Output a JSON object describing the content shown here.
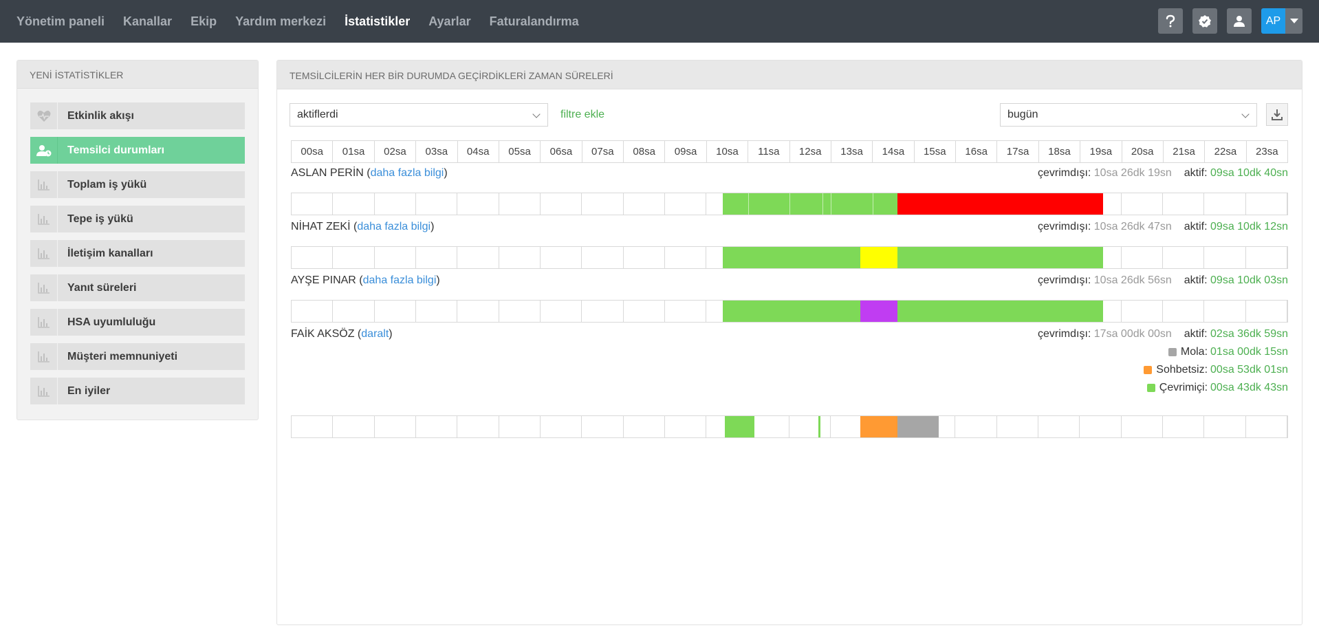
{
  "nav": {
    "items": [
      "Yönetim paneli",
      "Kanallar",
      "Ekip",
      "Yardım merkezi",
      "İstatistikler",
      "Ayarlar",
      "Faturalandırma"
    ],
    "active_index": 4,
    "avatar_initials": "AP"
  },
  "sidebar": {
    "title": "YENİ İSTATİSTİKLER",
    "items": [
      {
        "label": "Etkinlik akışı",
        "icon": "heartbeat-icon"
      },
      {
        "label": "Temsilci durumları",
        "icon": "user-status-icon",
        "active": true
      },
      {
        "label": "Toplam iş yükü",
        "icon": "bar-chart-icon"
      },
      {
        "label": "Tepe iş yükü",
        "icon": "bar-chart-icon"
      },
      {
        "label": "İletişim kanalları",
        "icon": "bar-chart-icon"
      },
      {
        "label": "Yanıt süreleri",
        "icon": "bar-chart-icon"
      },
      {
        "label": "HSA uyumluluğu",
        "icon": "bar-chart-icon"
      },
      {
        "label": "Müşteri memnuniyeti",
        "icon": "bar-chart-icon"
      },
      {
        "label": "En iyiler",
        "icon": "bar-chart-icon"
      }
    ]
  },
  "panel": {
    "title": "TEMSİLCİLERİN HER BİR DURUMDA GEÇİRDİKLERİ ZAMAN SÜRELERİ",
    "agent_filter": "aktiflerdi",
    "add_filter": "filtre ekle",
    "period": "bugün",
    "hours": [
      "00sa",
      "01sa",
      "02sa",
      "03sa",
      "04sa",
      "05sa",
      "06sa",
      "07sa",
      "08sa",
      "09sa",
      "10sa",
      "11sa",
      "12sa",
      "13sa",
      "14sa",
      "15sa",
      "16sa",
      "17sa",
      "18sa",
      "19sa",
      "20sa",
      "21sa",
      "22sa",
      "23sa"
    ]
  },
  "status_colors": {
    "active": "#7ed957",
    "offline": "#ff0000",
    "yellow": "#ffff00",
    "purple": "#c03df2",
    "break": "#a6a6a6",
    "not_chatting": "#ff9a33"
  },
  "agents": [
    {
      "name": "ASLAN PERİN",
      "link": "daha fazla bilgi",
      "offline_label": "çevrimdışı:",
      "offline": "10sa 26dk 19sn",
      "active_label": "aktif:",
      "active": "09sa 10dk 40sn",
      "segments": [
        {
          "status": "active",
          "start": 10.4,
          "end": 14.6
        },
        {
          "status": "offline",
          "start": 14.6,
          "end": 19.55
        }
      ],
      "dividers": [
        11.0,
        12.0,
        12.8,
        13.0,
        14.0
      ]
    },
    {
      "name": "NİHAT ZEKİ",
      "link": "daha fazla bilgi",
      "offline_label": "çevrimdışı:",
      "offline": "10sa 26dk 47sn",
      "active_label": "aktif:",
      "active": "09sa 10dk 12sn",
      "segments": [
        {
          "status": "active",
          "start": 10.4,
          "end": 13.7
        },
        {
          "status": "yellow",
          "start": 13.7,
          "end": 14.6
        },
        {
          "status": "active",
          "start": 14.6,
          "end": 19.55
        }
      ],
      "dividers": []
    },
    {
      "name": "AYŞE PINAR",
      "link": "daha fazla bilgi",
      "offline_label": "çevrimdışı:",
      "offline": "10sa 26dk 56sn",
      "active_label": "aktif:",
      "active": "09sa 10dk 03sn",
      "segments": [
        {
          "status": "active",
          "start": 10.4,
          "end": 13.7
        },
        {
          "status": "purple",
          "start": 13.7,
          "end": 14.6
        },
        {
          "status": "active",
          "start": 14.6,
          "end": 19.55
        }
      ],
      "dividers": []
    },
    {
      "name": "FAİK AKSÖZ",
      "link": "daralt",
      "offline_label": "çevrimdışı:",
      "offline": "17sa 00dk 00sn",
      "active_label": "aktif:",
      "active": "02sa 36dk 59sn",
      "legend": [
        {
          "label": "Mola:",
          "value": "01sa 00dk 15sn",
          "status": "break"
        },
        {
          "label": "Sohbetsiz:",
          "value": "00sa 53dk 01sn",
          "status": "not_chatting"
        },
        {
          "label": "Çevrimiçi:",
          "value": "00sa 43dk 43sn",
          "status": "active"
        }
      ],
      "segments": [
        {
          "status": "active",
          "start": 10.45,
          "end": 11.15
        },
        {
          "status": "active",
          "start": 12.7,
          "end": 12.75
        },
        {
          "status": "not_chatting",
          "start": 13.7,
          "end": 14.6
        },
        {
          "status": "break",
          "start": 14.6,
          "end": 15.6
        }
      ],
      "dividers": []
    }
  ]
}
